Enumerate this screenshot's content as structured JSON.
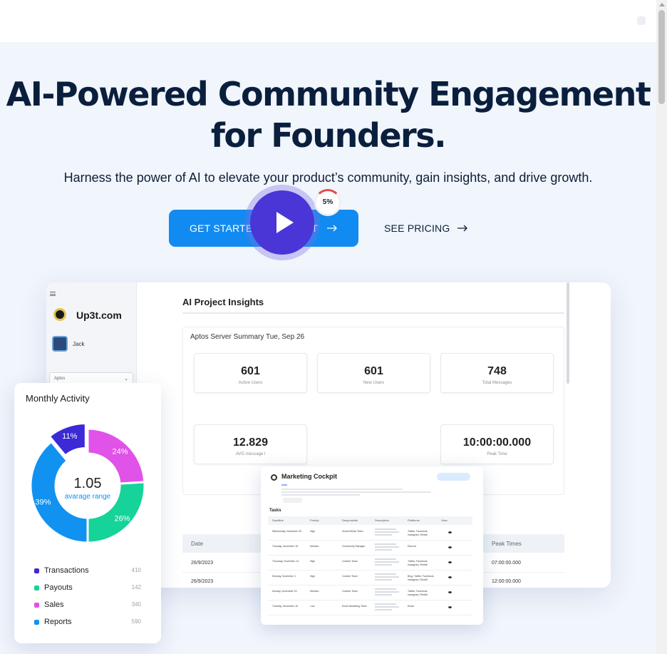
{
  "hero": {
    "headline_line1": "AI-Powered Community Engagement",
    "headline_line2": "for Founders.",
    "subtitle": "Harness the power of AI to elevate your product’s community, gain insights, and drive growth.",
    "cta_primary": "GET STARTED WITH UP3T",
    "cta_secondary": "SEE PRICING",
    "accent_color": "#118bf1"
  },
  "dashboard": {
    "brand": "Up3t.com",
    "user": "Jack",
    "select_value": "Aptos",
    "title": "AI Project Insights",
    "summary_title": "Aptos Server Summary Tue, Sep 26",
    "stats": [
      {
        "value": "601",
        "label": "Active Users"
      },
      {
        "value": "601",
        "label": "New Users"
      },
      {
        "value": "748",
        "label": "Total Messages"
      },
      {
        "value": "12.829",
        "label": "AVG message l"
      },
      {
        "value": "10:00:00.000",
        "label": "Peak Time"
      }
    ],
    "percent": "5%",
    "table": {
      "headers": [
        "Date",
        "Peak Times"
      ],
      "rows": [
        {
          "date": "26/9/2023",
          "peak": "07:00:00.000"
        },
        {
          "date": "26/9/2023",
          "peak": "12:00:00.000"
        }
      ]
    }
  },
  "activity": {
    "title": "Monthly Activity",
    "center_value": "1.05",
    "center_label": "avarage range",
    "segments": [
      {
        "label": "11%",
        "value": 11,
        "color": "#3b2ad6"
      },
      {
        "label": "24%",
        "value": 24,
        "color": "#e052e8"
      },
      {
        "label": "26%",
        "value": 26,
        "color": "#16d39a"
      },
      {
        "label": "39%",
        "value": 39,
        "color": "#1192f0"
      }
    ],
    "legend": [
      {
        "label": "Transactions",
        "value": "410",
        "color": "#3b2ad6"
      },
      {
        "label": "Payouts",
        "value": "142",
        "color": "#16d39a"
      },
      {
        "label": "Sales",
        "value": "340",
        "color": "#e052e8"
      },
      {
        "label": "Reports",
        "value": "590",
        "color": "#1192f0"
      }
    ]
  },
  "cockpit": {
    "title": "Marketing Cockpit",
    "tasks_label": "Tasks",
    "headers": [
      "Deadline",
      "Priority",
      "Responsible",
      "Description",
      "Platforms",
      "View"
    ],
    "rows": [
      {
        "deadline": "Wednesday, November 30",
        "priority": "High",
        "responsible": "Social Media Team",
        "platforms": "Twitter, Facebook, Instagram, Reddit"
      },
      {
        "deadline": "Tuesday, November 15",
        "priority": "Medium",
        "responsible": "Community Manager",
        "platforms": "Discord"
      },
      {
        "deadline": "Thursday, November 10",
        "priority": "High",
        "responsible": "Content Team",
        "platforms": "Twitter, Facebook, Instagram, Reddit"
      },
      {
        "deadline": "Monday, November 1",
        "priority": "High",
        "responsible": "Content Team",
        "platforms": "Blog, Twitter, Facebook, Instagram, Reddit"
      },
      {
        "deadline": "Sunday, November 20",
        "priority": "Medium",
        "responsible": "Content Team",
        "platforms": "Twitter, Facebook, Instagram, Reddit"
      },
      {
        "deadline": "Tuesday, November 15",
        "priority": "Low",
        "responsible": "Email Marketing Team",
        "platforms": "Email"
      }
    ]
  }
}
